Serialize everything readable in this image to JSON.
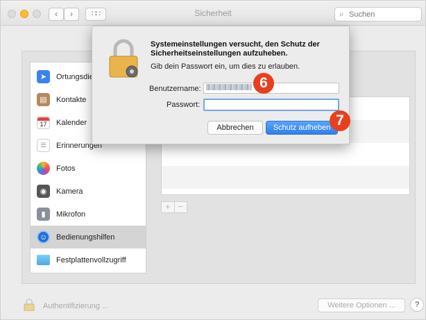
{
  "window": {
    "title": "Sicherheit",
    "search_placeholder": "Suchen"
  },
  "sidebar": {
    "items": [
      {
        "label": "Ortungsdienste",
        "icon": "location-arrow-icon",
        "color": "#3b82f0"
      },
      {
        "label": "Kontakte",
        "icon": "contacts-book-icon",
        "color": "#b5895b"
      },
      {
        "label": "Kalender",
        "icon": "calendar-icon",
        "color": "#ffffff",
        "day": "17"
      },
      {
        "label": "Erinnerungen",
        "icon": "reminders-list-icon",
        "color": "#ffffff"
      },
      {
        "label": "Fotos",
        "icon": "photos-flower-icon",
        "color": "#ffffff"
      },
      {
        "label": "Kamera",
        "icon": "camera-icon",
        "color": "#555555"
      },
      {
        "label": "Mikrofon",
        "icon": "microphone-icon",
        "color": "#8a8f99"
      },
      {
        "label": "Bedienungshilfen",
        "icon": "accessibility-icon",
        "color": "#1f6fd6"
      },
      {
        "label": "Festplattenvollzugriff",
        "icon": "folder-icon",
        "color": "#5ab9f0"
      }
    ],
    "selected_index": 7
  },
  "bottom": {
    "auth_label": "Authentifizierung ...",
    "more_options_label": "Weitere Optionen ...",
    "help_label": "?"
  },
  "dialog": {
    "title": "Systemeinstellungen versucht, den Schutz der Sicherheitseinstellungen aufzuheben.",
    "subtitle": "Gib dein Passwort ein, um dies zu erlauben.",
    "username_label": "Benutzername:",
    "password_label": "Passwort:",
    "password_value": "",
    "cancel_label": "Abbrechen",
    "confirm_label": "Schutz aufheben"
  },
  "steps": {
    "step6": "6",
    "step7": "7"
  },
  "list_controls": {
    "add": "+",
    "remove": "−"
  }
}
